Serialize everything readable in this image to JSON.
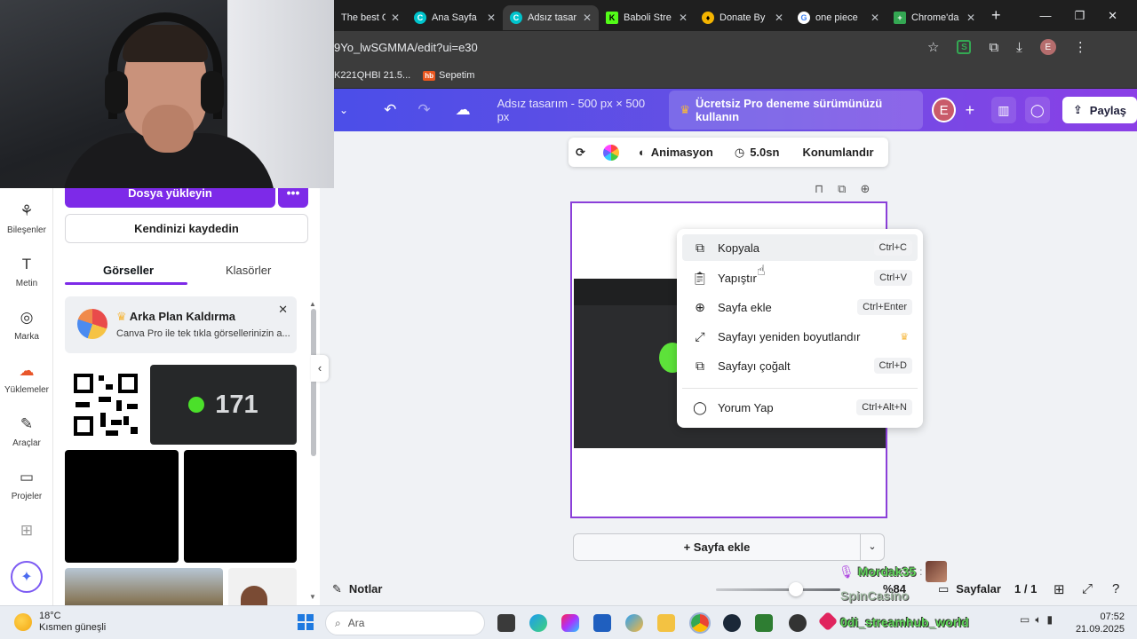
{
  "browser": {
    "tabs": [
      {
        "title": "The best C",
        "favicon": "none",
        "color": "#1f1f1f"
      },
      {
        "title": "Ana Sayfa",
        "favicon": "canva-icon",
        "color": "#00c4cc"
      },
      {
        "title": "Adsız tasar",
        "favicon": "canva-icon",
        "color": "#00c4cc",
        "active": true
      },
      {
        "title": "Baboli Stre",
        "favicon": "kick-icon",
        "color": "#53fc18"
      },
      {
        "title": "Donate By",
        "favicon": "donate-icon",
        "color": "#f4b400"
      },
      {
        "title": "one piece",
        "favicon": "google-icon",
        "color": "#4285f4"
      },
      {
        "title": "Chrome'da",
        "favicon": "plus-icon",
        "color": "#34a853"
      }
    ],
    "url": "9Yo_lwSGMMA/edit?ui=e30",
    "bookmarks": [
      {
        "label": "K221QHBI 21.5..."
      },
      {
        "label": "Sepetim",
        "badge": "hb"
      }
    ],
    "profile_initial": "E",
    "extension_letter": "S"
  },
  "canva_header": {
    "doc_title": "Adsız tasarım - 500 px × 500 px",
    "pro_label": "Ücretsiz Pro deneme sürümünüzü kullanın",
    "avatar_initial": "E",
    "share_label": "Paylaş"
  },
  "rail": [
    {
      "label": "Bileşenler",
      "icon": "elements-icon"
    },
    {
      "label": "Metin",
      "icon": "text-icon"
    },
    {
      "label": "Marka",
      "icon": "brand-icon"
    },
    {
      "label": "Yüklemeler",
      "icon": "upload-icon",
      "active": true
    },
    {
      "label": "Araçlar",
      "icon": "tools-icon"
    },
    {
      "label": "Projeler",
      "icon": "folder-icon"
    }
  ],
  "panel": {
    "upload_label": "Dosya yükleyin",
    "record_label": "Kendinizi kaydedin",
    "tabs": [
      "Görseller",
      "Klasörler"
    ],
    "promo_title": "Arka Plan Kaldırma",
    "promo_sub": "Canva Pro ile tek tıkla görsellerinizin a...",
    "thumb_number": "171"
  },
  "toolbar": {
    "animation_label": "Animasyon",
    "duration_label": "5.0sn",
    "position_label": "Konumlandır"
  },
  "context_menu": [
    {
      "label": "Kopyala",
      "shortcut": "Ctrl+C",
      "icon": "copy-icon"
    },
    {
      "label": "Yapıştır",
      "shortcut": "Ctrl+V",
      "icon": "paste-icon"
    },
    {
      "label": "Sayfa ekle",
      "shortcut": "Ctrl+Enter",
      "icon": "add-page-icon"
    },
    {
      "label": "Sayfayı yeniden boyutlandır",
      "shortcut": "",
      "icon": "resize-icon",
      "pro": true
    },
    {
      "label": "Sayfayı çoğalt",
      "shortcut": "Ctrl+D",
      "icon": "duplicate-icon"
    },
    {
      "label": "Yorum Yap",
      "shortcut": "Ctrl+Alt+N",
      "icon": "comment-icon"
    }
  ],
  "add_page_label": "+ Sayfa ekle",
  "bottom": {
    "notes_label": "Notlar",
    "zoom": "%84",
    "pages_label": "Sayfalar",
    "page_count": "1 / 1"
  },
  "overlays": {
    "chat_name": "Mordak35",
    "casino": "SpinCasino",
    "stream_handle": "0di_streamhub_world"
  },
  "taskbar": {
    "temperature": "18°C",
    "weather": "Kısmen güneşli",
    "search_placeholder": "Ara",
    "time": "07:52",
    "date": "21.09.2025"
  },
  "colors": {
    "canva_purple": "#7d2ae8",
    "header_start": "#4b4ee8",
    "header_end": "#8b3fe6",
    "accent_green": "#5de23a"
  }
}
